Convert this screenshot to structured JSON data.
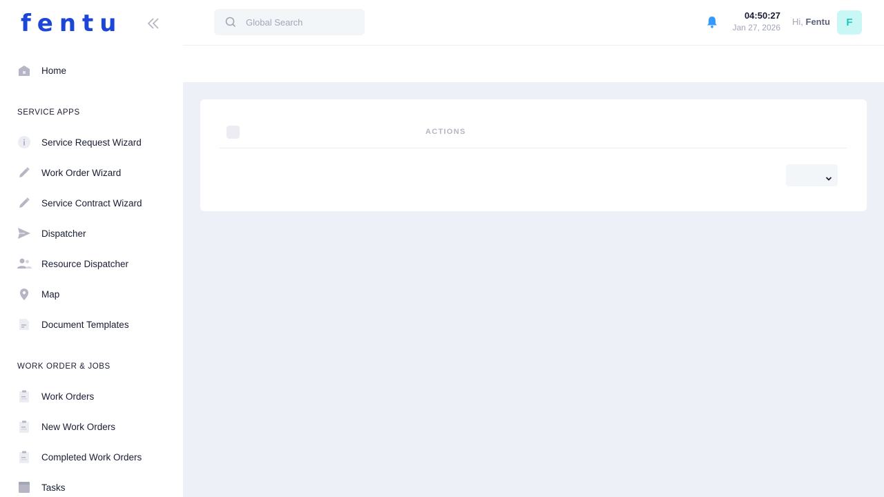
{
  "brand": {
    "logo_text": "fentu",
    "logo_color": "#1b46d8"
  },
  "sidebar": {
    "home": {
      "label": "Home",
      "icon": "home-icon"
    },
    "sections": [
      {
        "title": "SERVICE APPS",
        "items": [
          {
            "label": "Service Request Wizard",
            "icon": "info-icon"
          },
          {
            "label": "Work Order Wizard",
            "icon": "pencil-icon"
          },
          {
            "label": "Service Contract Wizard",
            "icon": "pencil-icon"
          },
          {
            "label": "Dispatcher",
            "icon": "send-icon"
          },
          {
            "label": "Resource Dispatcher",
            "icon": "users-icon"
          },
          {
            "label": "Map",
            "icon": "map-pin-icon"
          },
          {
            "label": "Document Templates",
            "icon": "document-icon"
          }
        ]
      },
      {
        "title": "WORK ORDER & JOBS",
        "items": [
          {
            "label": "Work Orders",
            "icon": "clipboard-icon"
          },
          {
            "label": "New Work Orders",
            "icon": "clipboard-icon"
          },
          {
            "label": "Completed Work Orders",
            "icon": "clipboard-icon"
          },
          {
            "label": "Tasks",
            "icon": "task-icon"
          }
        ]
      }
    ]
  },
  "header": {
    "search_placeholder": "Global Search",
    "time": "04:50:27",
    "date": "Jan 27, 2026",
    "greeting": "Hi,",
    "user_name": "Fentu",
    "avatar_initial": "F",
    "accent_color": "#3699ff"
  },
  "table": {
    "columns": [
      "ACTIONS"
    ],
    "row_select_value": ""
  }
}
